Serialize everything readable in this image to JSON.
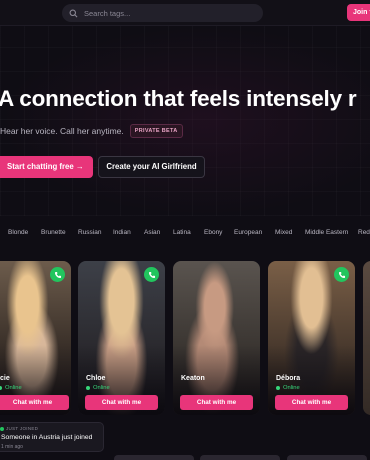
{
  "header": {
    "search_placeholder": "Search tags...",
    "join_label": "Join f",
    "search_icon": "search-icon"
  },
  "hero": {
    "headline": "A connection that feels intensely r",
    "subline": "Hear her voice. Call her anytime.",
    "badge": "PRIVATE BETA",
    "cta_primary": "Start chatting free →",
    "cta_secondary": "Create your AI Girlfriend"
  },
  "tags": [
    "Blonde",
    "Brunette",
    "Russian",
    "Indian",
    "Asian",
    "Latina",
    "Ebony",
    "European",
    "Mixed",
    "Middle Eastern",
    "Red"
  ],
  "cards": [
    {
      "name": "cie",
      "status": "Online",
      "chat_label": "Chat with me",
      "phone_icon": "phone-icon"
    },
    {
      "name": "Chloe",
      "status": "Online",
      "chat_label": "Chat with me",
      "phone_icon": "phone-icon"
    },
    {
      "name": "Keaton",
      "status": "",
      "chat_label": "Chat with me",
      "phone_icon": "phone-icon"
    },
    {
      "name": "Débora",
      "status": "Online",
      "chat_label": "Chat with me",
      "phone_icon": "phone-icon"
    }
  ],
  "toast": {
    "kicker": "JUST JOINED",
    "message": "Someone in Austria just joined",
    "time": "1 min ago"
  },
  "colors": {
    "accent": "#e8357a",
    "online": "#22c55e",
    "background": "#0f0d14"
  }
}
